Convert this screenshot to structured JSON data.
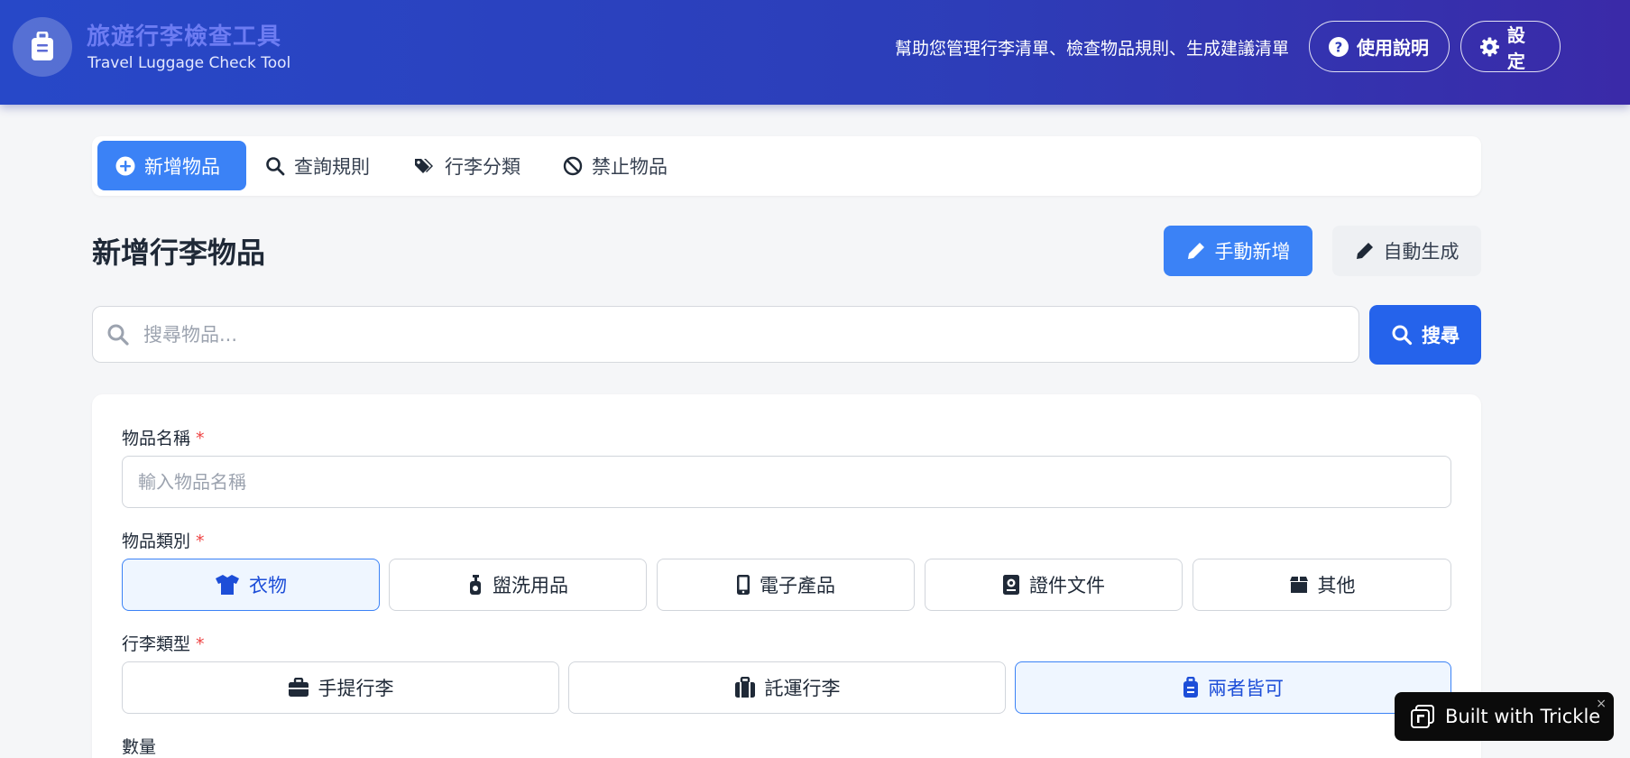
{
  "header": {
    "title": "旅遊行李檢查工具",
    "subtitle": "Travel Luggage Check Tool",
    "description": "幫助您管理行李清單、檢查物品規則、生成建議清單",
    "help_label": "使用說明",
    "settings_label": "設定",
    "logo_icon": "luggage-icon"
  },
  "tabs": [
    {
      "label": "新增物品",
      "icon": "plus-circle-icon",
      "active": true
    },
    {
      "label": "查詢規則",
      "icon": "search-icon",
      "active": false
    },
    {
      "label": "行李分類",
      "icon": "tags-icon",
      "active": false
    },
    {
      "label": "禁止物品",
      "icon": "ban-icon",
      "active": false
    }
  ],
  "section": {
    "title": "新增行李物品",
    "manual_label": "手動新增",
    "auto_label": "自動生成"
  },
  "search": {
    "placeholder": "搜尋物品...",
    "button_label": "搜尋"
  },
  "form": {
    "name_label": "物品名稱",
    "required_mark": "*",
    "name_placeholder": "輸入物品名稱",
    "category_label": "物品類別",
    "categories": [
      {
        "label": "衣物",
        "icon": "shirt-icon",
        "selected": true
      },
      {
        "label": "盥洗用品",
        "icon": "pump-bottle-icon",
        "selected": false
      },
      {
        "label": "電子產品",
        "icon": "mobile-icon",
        "selected": false
      },
      {
        "label": "證件文件",
        "icon": "passport-icon",
        "selected": false
      },
      {
        "label": "其他",
        "icon": "box-icon",
        "selected": false
      }
    ],
    "luggage_label": "行李類型",
    "luggage_types": [
      {
        "label": "手提行李",
        "icon": "briefcase-icon",
        "selected": false
      },
      {
        "label": "託運行李",
        "icon": "suitcase-icon",
        "selected": false
      },
      {
        "label": "兩者皆可",
        "icon": "luggage-icon",
        "selected": true
      }
    ],
    "quantity_label": "數量"
  },
  "badge": {
    "label": "Built with Trickle",
    "close": "×"
  },
  "colors": {
    "primary": "#3b82f6",
    "search_button": "#2563eb",
    "header_gradient_start": "#2748c8",
    "header_gradient_end": "#3a2aa8",
    "required": "#ef4444"
  }
}
